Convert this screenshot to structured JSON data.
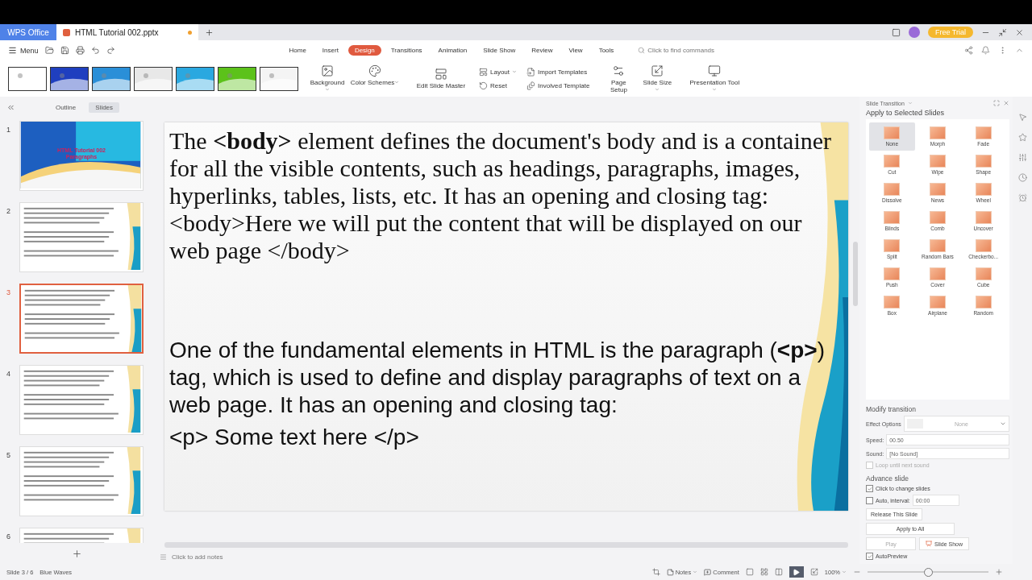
{
  "title_bar": {
    "brand": "WPS Office",
    "free_trial": "Free Trial"
  },
  "tabs": [
    {
      "label": "HTML Tutorial 002.pptx",
      "selected": true
    }
  ],
  "toolbar": {
    "menu": "Menu"
  },
  "ribbon_tabs": [
    {
      "label": "Home",
      "selected": false
    },
    {
      "label": "Insert",
      "selected": false
    },
    {
      "label": "Design",
      "selected": true
    },
    {
      "label": "Transitions",
      "selected": false
    },
    {
      "label": "Animation",
      "selected": false
    },
    {
      "label": "Slide Show",
      "selected": false
    },
    {
      "label": "Review",
      "selected": false
    },
    {
      "label": "View",
      "selected": false
    },
    {
      "label": "Tools",
      "selected": false
    }
  ],
  "search": {
    "placeholder": "Click to find commands"
  },
  "templates": [
    {
      "color": "#ffffff"
    },
    {
      "color": "#1f3fbf"
    },
    {
      "color": "#2a8fd8"
    },
    {
      "color": "#e8e8e8"
    },
    {
      "color": "#2aa8e0"
    },
    {
      "color": "#5cc21a"
    },
    {
      "color": "#f4f4f4"
    }
  ],
  "ribbon_groups": [
    {
      "kind": "big",
      "items": [
        {
          "label": "Background",
          "dropdown": true
        },
        {
          "label": "Color Schemes",
          "dropdown": true
        }
      ]
    },
    {
      "kind": "big",
      "items": [
        {
          "label": "Edit Slide Master",
          "dropdown": false
        }
      ]
    },
    {
      "kind": "stack",
      "items": [
        {
          "label": "Layout",
          "dropdown": true
        },
        {
          "label": "Reset",
          "dropdown": false
        }
      ]
    },
    {
      "kind": "stack",
      "items": [
        {
          "label": "Import Templates",
          "dropdown": false
        },
        {
          "label": "Involved Template",
          "dropdown": false
        }
      ]
    },
    {
      "kind": "big",
      "items": [
        {
          "label": "Page Setup",
          "dropdown": false
        },
        {
          "label": "Slide Size",
          "dropdown": true
        }
      ]
    },
    {
      "kind": "big",
      "items": [
        {
          "label": "Presentation Tool",
          "dropdown": true
        }
      ]
    }
  ],
  "panel_tabs": [
    {
      "label": "Outline",
      "selected": false
    },
    {
      "label": "Slides",
      "selected": true
    }
  ],
  "slides": [
    {
      "number": "1",
      "kind": "title",
      "selected": false,
      "title": "HTML Tutorial 002",
      "subtitle": "Paragraphs"
    },
    {
      "number": "2",
      "kind": "content",
      "selected": false
    },
    {
      "number": "3",
      "kind": "content",
      "selected": true
    },
    {
      "number": "4",
      "kind": "content",
      "selected": false
    },
    {
      "number": "5",
      "kind": "content",
      "selected": false
    },
    {
      "number": "6",
      "kind": "content",
      "selected": false
    }
  ],
  "slide": {
    "sections": [
      {
        "kind": "intro",
        "paragraphs": [
          "The **<body>** element defines the document's body and is a container for all the visible contents, such as headings, paragraphs, images, hyperlinks, tables, lists, etc. It has an opening and closing tag:",
          "<body>Here we will put the content that will be displayed on our web page </body>"
        ]
      },
      {
        "kind": "detail",
        "paragraphs": [
          "One of the fundamental elements in HTML is the paragraph (**<p>**) tag, which is used to define and display paragraphs of text on a web page. It has an opening and closing tag:",
          "<p> Some text here </p>"
        ]
      }
    ]
  },
  "notes": {
    "placeholder": "Click to add notes"
  },
  "transition_panel": {
    "title": "Slide Transition",
    "apply_label": "Apply to Selected Slides",
    "transitions": [
      {
        "label": "None",
        "selected": true
      },
      {
        "label": "Morph",
        "selected": false
      },
      {
        "label": "Fade",
        "selected": false
      },
      {
        "label": "Cut",
        "selected": false
      },
      {
        "label": "Wipe",
        "selected": false
      },
      {
        "label": "Shape",
        "selected": false
      },
      {
        "label": "Dissolve",
        "selected": false
      },
      {
        "label": "News",
        "selected": false
      },
      {
        "label": "Wheel",
        "selected": false
      },
      {
        "label": "Blinds",
        "selected": false
      },
      {
        "label": "Comb",
        "selected": false
      },
      {
        "label": "Uncover",
        "selected": false
      },
      {
        "label": "Split",
        "selected": false
      },
      {
        "label": "Random Bars",
        "selected": false
      },
      {
        "label": "Checkerbo...",
        "selected": false
      },
      {
        "label": "Push",
        "selected": false
      },
      {
        "label": "Cover",
        "selected": false
      },
      {
        "label": "Cube",
        "selected": false
      },
      {
        "label": "Box",
        "selected": false
      },
      {
        "label": "Airplane",
        "selected": false
      },
      {
        "label": "Random",
        "selected": false
      }
    ],
    "modify_title": "Modify transition",
    "effect_label": "Effect Options",
    "effect_value": "None",
    "speed_label": "Speed:",
    "speed_value": "00.50",
    "sound_label": "Sound:",
    "sound_value": "[No Sound]",
    "loop": {
      "label": "Loop until next sound",
      "checked": false,
      "disabled": true
    },
    "advance_title": "Advance slide",
    "click_advance": {
      "label": "Click to change slides",
      "checked": true
    },
    "auto_advance": {
      "label": "Auto, interval:",
      "checked": false,
      "value": "00:00"
    },
    "release_button": "Release This Slide",
    "apply_all_button": "Apply to All",
    "play_button": {
      "label": "Play",
      "disabled": true
    },
    "slideshow_button": "Slide Show",
    "autopreview": {
      "label": "AutoPreview",
      "checked": true
    }
  },
  "status_bar": {
    "slide_position": "Slide 3 / 6",
    "theme": "Blue Waves",
    "notes": "Notes",
    "comment": "Comment",
    "zoom": "100%",
    "zoom_slider": {
      "level": 0.5
    }
  }
}
